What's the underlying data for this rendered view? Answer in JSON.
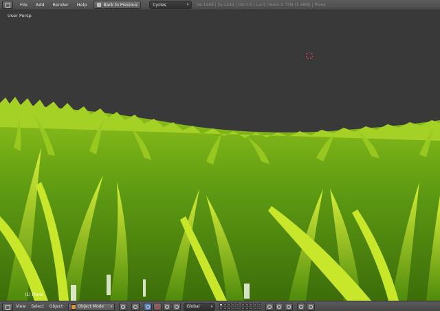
{
  "top_header": {
    "menus": [
      "File",
      "Add",
      "Render",
      "Help"
    ],
    "back_button": "Back to Previous",
    "render_engine": "Cycles",
    "stats": "Ve:1469 | Fa:1240 | Ob:0-5 | La:0 | Mem:3.73M (1.88M) | Plane"
  },
  "viewport": {
    "view_label": "User Persp",
    "object_label": "(1) Plane"
  },
  "bottom_header": {
    "menus": [
      "View",
      "Select",
      "Object"
    ],
    "mode": "Object Mode",
    "orientation": "Global"
  },
  "colors": {
    "background": "#393939",
    "grass_light": "#c8e62a",
    "grass_dark": "#3f7a0a",
    "active_button": "#5c85b8"
  }
}
